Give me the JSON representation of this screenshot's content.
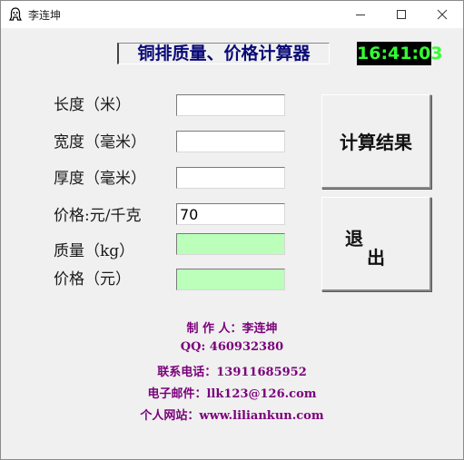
{
  "window": {
    "title": "李连坤",
    "controls": {
      "minimize": "—",
      "maximize": "☐",
      "close": "✕"
    }
  },
  "header": {
    "title": "铜排质量、价格计算器",
    "clock": "16:41:03"
  },
  "form": {
    "length": {
      "label": "长度（米）",
      "value": ""
    },
    "width": {
      "label": "宽度（毫米）",
      "value": ""
    },
    "thickness": {
      "label": "厚度（毫米）",
      "value": ""
    },
    "unit_price": {
      "label": "价格:元/千克",
      "value": "70"
    },
    "mass": {
      "label": "质量（kg）",
      "value": ""
    },
    "price": {
      "label": "价格（元）",
      "value": ""
    }
  },
  "buttons": {
    "calculate": "计算结果",
    "exit_line1": "退",
    "exit_line2": "出"
  },
  "credits": {
    "author": "制 作 人：李连坤",
    "qq": "QQ: 460932380",
    "phone": "联系电话：13911685952",
    "email": "电子邮件：llk123@126.com",
    "website": "个人网站：www.liliankun.com"
  },
  "colors": {
    "title_text": "#0a0a78",
    "clock_bg": "#000000",
    "clock_fg": "#33ff33",
    "result_field_bg": "#bbffbb",
    "credits_text": "#7a007a"
  }
}
